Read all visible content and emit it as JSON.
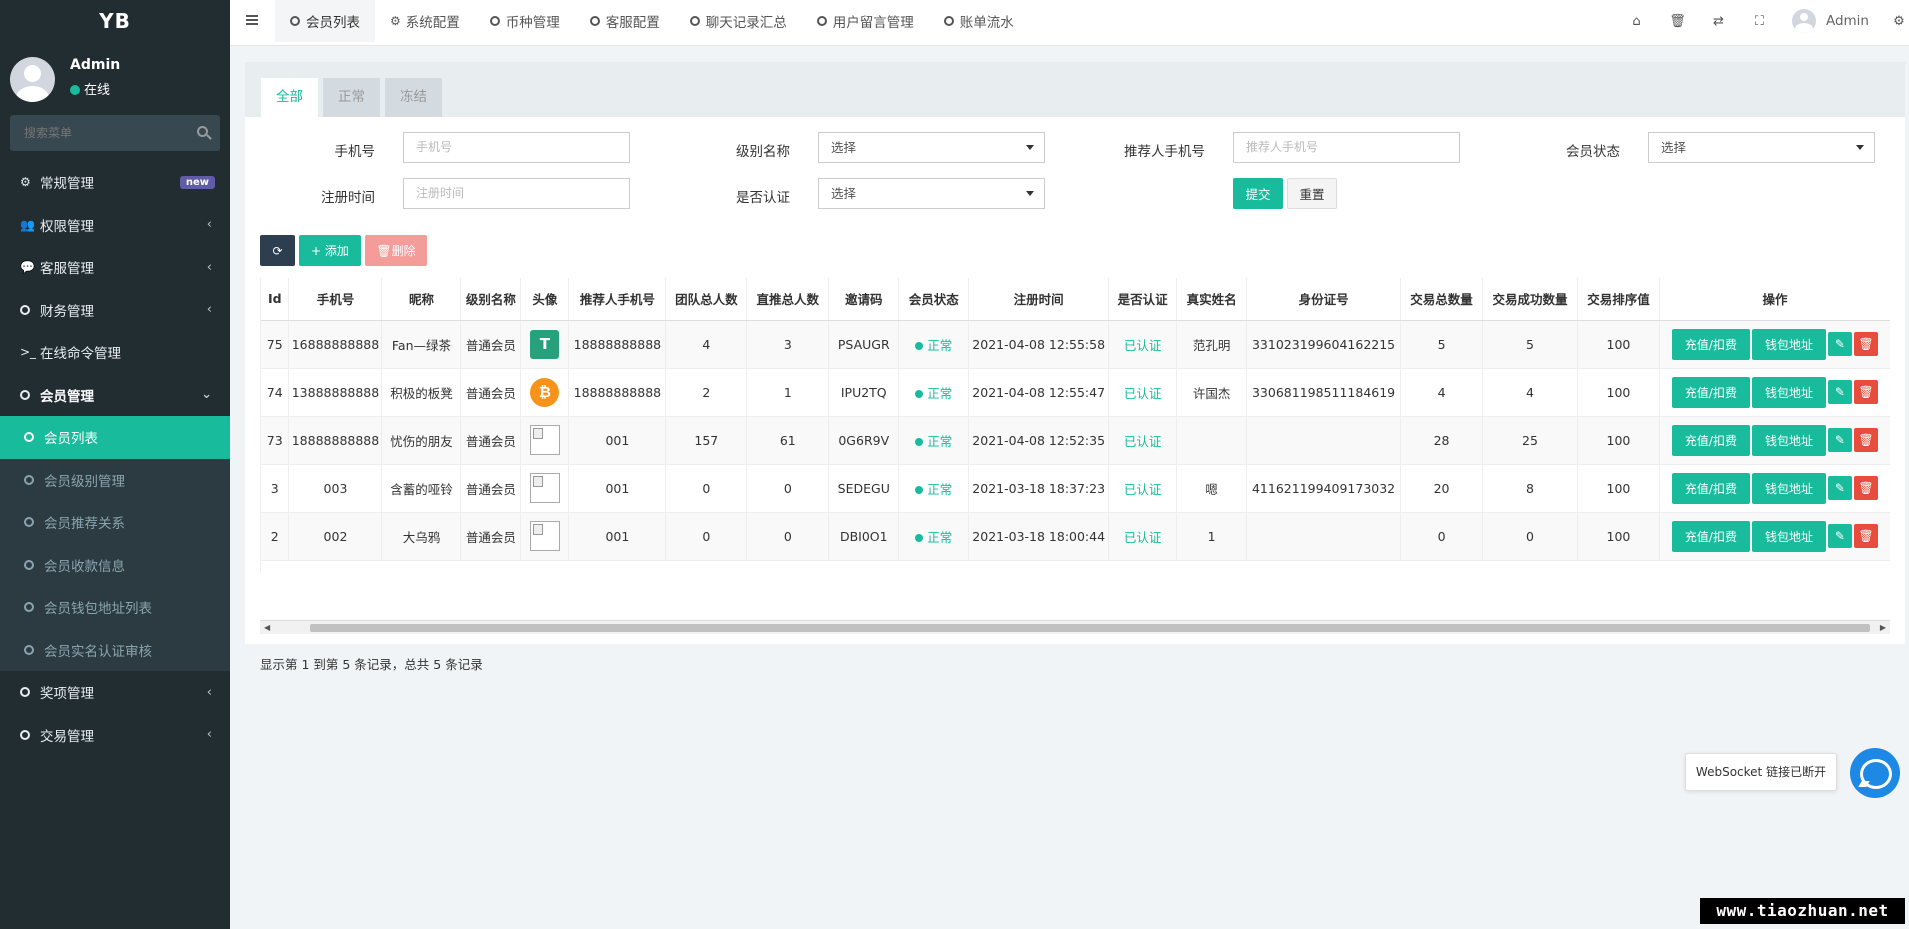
{
  "sidebar": {
    "logo": "YB",
    "user": {
      "name": "Admin",
      "status": "在线"
    },
    "search_placeholder": "搜索菜单",
    "items": [
      {
        "label": "常规管理",
        "icon": "cogs-icon",
        "badge": "new"
      },
      {
        "label": "权限管理",
        "icon": "group-icon"
      },
      {
        "label": "客服管理",
        "icon": "comment-icon"
      },
      {
        "label": "财务管理",
        "icon": "circle-icon"
      },
      {
        "label": "在线命令管理",
        "icon": "terminal-icon"
      },
      {
        "label": "会员管理",
        "icon": "circle-icon"
      }
    ],
    "submenu": [
      "会员列表",
      "会员级别管理",
      "会员推荐关系",
      "会员收款信息",
      "会员钱包地址列表",
      "会员实名认证审核"
    ],
    "after_items": [
      {
        "label": "奖项管理"
      },
      {
        "label": "交易管理"
      }
    ]
  },
  "topnav": {
    "tabs": [
      "会员列表",
      "系统配置",
      "币种管理",
      "客服配置",
      "聊天记录汇总",
      "用户留言管理",
      "账单流水"
    ],
    "user": "Admin"
  },
  "panel": {
    "tabs": [
      "全部",
      "正常",
      "冻结"
    ],
    "filters": {
      "phone_label": "手机号",
      "phone_placeholder": "手机号",
      "level_label": "级别名称",
      "level_value": "选择",
      "referrer_label": "推荐人手机号",
      "referrer_placeholder": "推荐人手机号",
      "status_label": "会员状态",
      "status_value": "选择",
      "regtime_label": "注册时间",
      "regtime_placeholder": "注册时间",
      "verified_label": "是否认证",
      "verified_value": "选择",
      "submit": "提交",
      "reset": "重置"
    },
    "toolbar": {
      "add": "添加",
      "delete": "删除"
    },
    "columns": [
      "Id",
      "手机号",
      "昵称",
      "级别名称",
      "头像",
      "推荐人手机号",
      "团队总人数",
      "直推总人数",
      "邀请码",
      "会员状态",
      "注册时间",
      "是否认证",
      "真实姓名",
      "身份证号",
      "交易总数量",
      "交易成功数量",
      "交易排序值",
      "操作"
    ],
    "rows": [
      {
        "id": "75",
        "phone": "16888888888",
        "nick": "Fan—绿茶",
        "level": "普通会员",
        "avatar": "usdt",
        "ref": "18888888888",
        "team": "4",
        "direct": "3",
        "code": "PSAUGR",
        "status": "正常",
        "time": "2021-04-08 12:55:58",
        "verified": "已认证",
        "name": "范孔明",
        "idno": "331023199604162215",
        "total": "5",
        "success": "5",
        "sort": "100"
      },
      {
        "id": "74",
        "phone": "13888888888",
        "nick": "积极的板凳",
        "level": "普通会员",
        "avatar": "btc",
        "ref": "18888888888",
        "team": "2",
        "direct": "1",
        "code": "IPU2TQ",
        "status": "正常",
        "time": "2021-04-08 12:55:47",
        "verified": "已认证",
        "name": "许国杰",
        "idno": "330681198511184619",
        "total": "4",
        "success": "4",
        "sort": "100"
      },
      {
        "id": "73",
        "phone": "18888888888",
        "nick": "忧伤的朋友",
        "level": "普通会员",
        "avatar": "broken",
        "ref": "001",
        "team": "157",
        "direct": "61",
        "code": "0G6R9V",
        "status": "正常",
        "time": "2021-04-08 12:52:35",
        "verified": "已认证",
        "name": "",
        "idno": "",
        "total": "28",
        "success": "25",
        "sort": "100"
      },
      {
        "id": "3",
        "phone": "003",
        "nick": "含蓄的哑铃",
        "level": "普通会员",
        "avatar": "broken",
        "ref": "001",
        "team": "0",
        "direct": "0",
        "code": "SEDEGU",
        "status": "正常",
        "time": "2021-03-18 18:37:23",
        "verified": "已认证",
        "name": "嗯",
        "idno": "411621199409173032",
        "total": "20",
        "success": "8",
        "sort": "100"
      },
      {
        "id": "2",
        "phone": "002",
        "nick": "大乌鸦",
        "level": "普通会员",
        "avatar": "broken",
        "ref": "001",
        "team": "0",
        "direct": "0",
        "code": "DBI0O1",
        "status": "正常",
        "time": "2021-03-18 18:00:44",
        "verified": "已认证",
        "name": "1",
        "idno": "",
        "total": "0",
        "success": "0",
        "sort": "100"
      }
    ],
    "op_labels": {
      "charge": "充值/扣费",
      "wallet": "钱包地址"
    },
    "pager_info": "显示第 1 到第 5 条记录，总共 5 条记录"
  },
  "toast": "WebSocket 链接已断开",
  "watermark": "www.tiaozhuan.net",
  "colors": {
    "accent": "#18bc9c",
    "sidebar": "#222d32",
    "danger": "#e74c3c"
  }
}
